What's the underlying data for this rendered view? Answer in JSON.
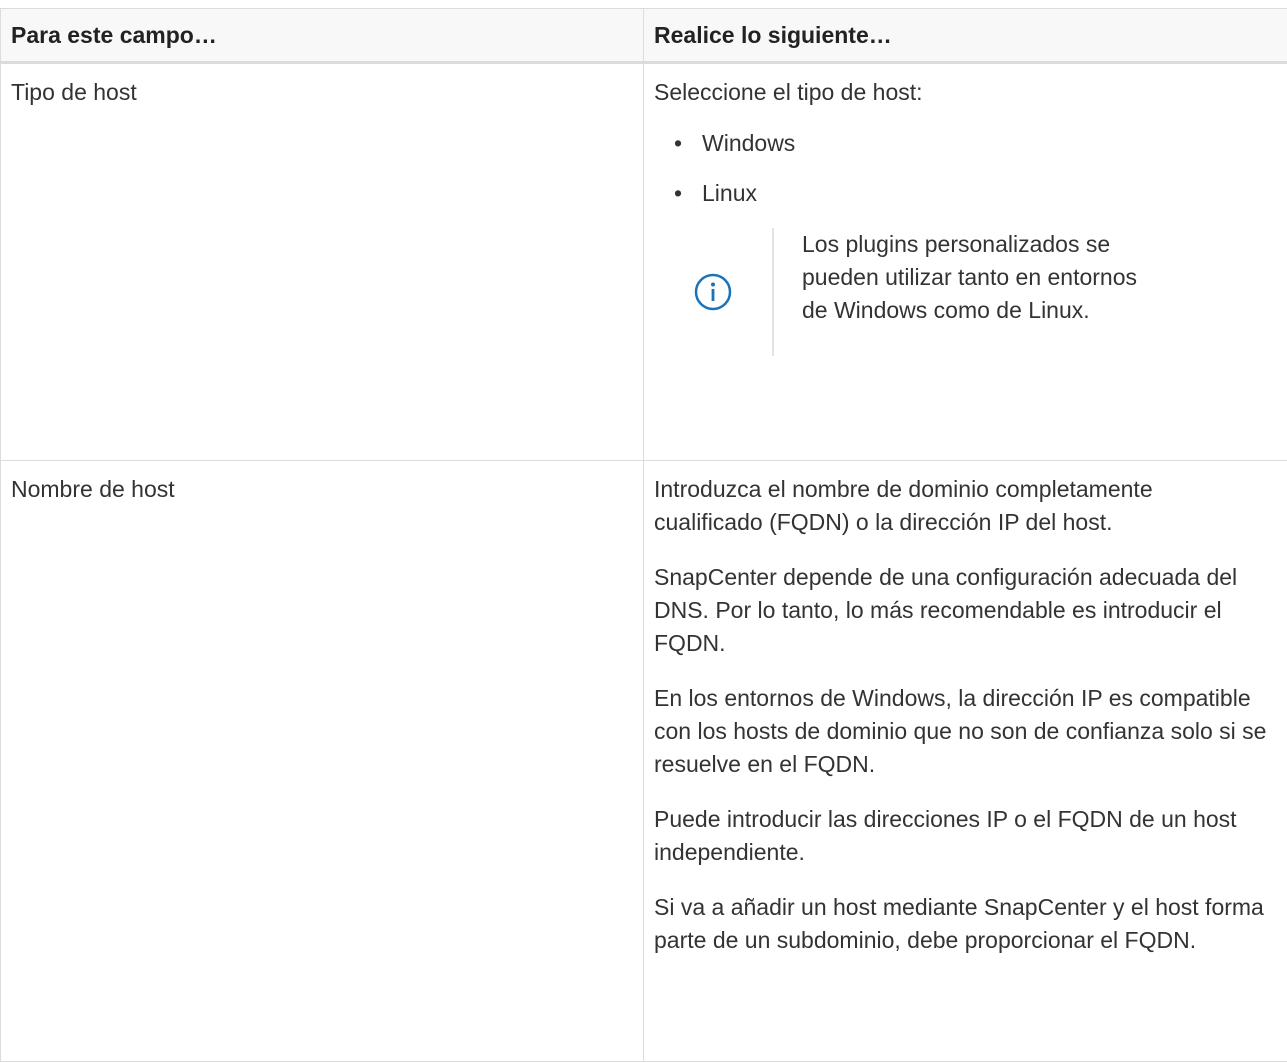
{
  "table": {
    "headers": [
      "Para este campo…",
      "Realice lo siguiente…"
    ],
    "rows": [
      {
        "field": "Tipo de host",
        "action_intro": "Seleccione el tipo de host:",
        "options": [
          "Windows",
          "Linux"
        ],
        "note": "Los plugins personalizados se pueden utilizar tanto en entornos de Windows como de Linux.",
        "note_icon": "info-icon"
      },
      {
        "field": "Nombre de host",
        "paragraphs": [
          "Introduzca el nombre de dominio completamente cualificado (FQDN) o la dirección IP del host.",
          "SnapCenter depende de una configuración adecuada del DNS. Por lo tanto, lo más recomendable es introducir el FQDN.",
          "En los entornos de Windows, la dirección IP es compatible con los hosts de dominio que no son de confianza solo si se resuelve en el FQDN.",
          "Puede introducir las direcciones IP o el FQDN de un host independiente.",
          "Si va a añadir un host mediante SnapCenter y el host forma parte de un subdominio, debe proporcionar el FQDN."
        ]
      }
    ]
  },
  "colors": {
    "text": "#333333",
    "border": "#dcdcdc",
    "header_bg": "#f8f8f8",
    "info_icon": "#1a73b8"
  }
}
